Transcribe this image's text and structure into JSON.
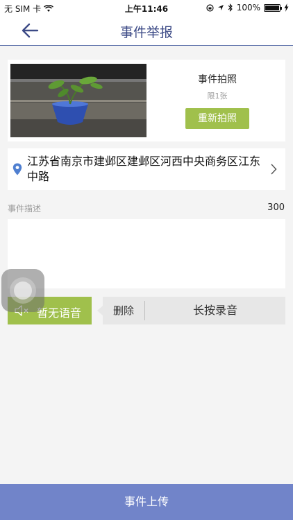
{
  "status_bar": {
    "carrier": "无 SIM 卡",
    "time": "上午11:46",
    "battery": "100%"
  },
  "nav": {
    "title": "事件举报"
  },
  "photo": {
    "title": "事件拍照",
    "limit": "限1张",
    "retake_label": "重新拍照"
  },
  "location": {
    "address": "江苏省南京市建邺区建邺区河西中央商务区江东中路"
  },
  "description": {
    "label": "事件描述",
    "count": "300",
    "value": ""
  },
  "voice": {
    "status_label": "暂无语音",
    "delete_label": "删除",
    "hold_label": "长按录音"
  },
  "submit": {
    "label": "事件上传"
  },
  "colors": {
    "accent_green": "#a0c04c",
    "title_blue": "#3c4a86",
    "submit_blue": "#7184c9",
    "pin_blue": "#4f7fd0"
  }
}
